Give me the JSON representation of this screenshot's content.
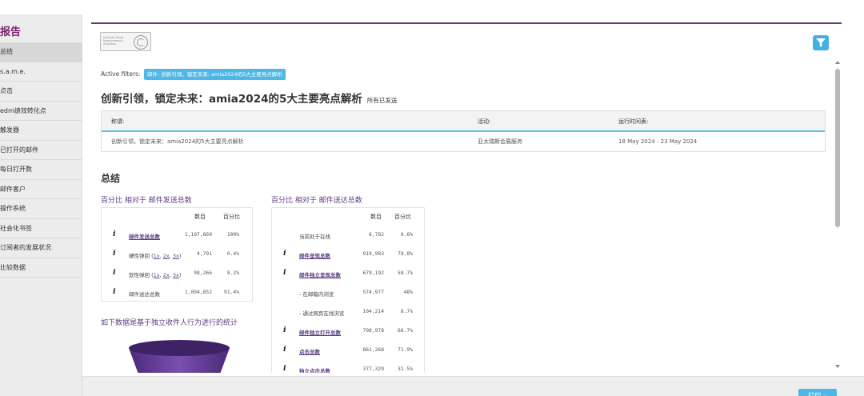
{
  "sidebar": {
    "title": "报告",
    "items": [
      "总结",
      "s.a.m.e.",
      "点击",
      "edm绩效转化点",
      "触发器",
      "已打开的邮件",
      "每日打开数",
      "邮件客户",
      "操作系统",
      "社会化书签",
      "订阅者的发展状况",
      "比较数据"
    ],
    "active_index": 0
  },
  "header": {
    "logo_text": "Institute Email Measurement Analytics",
    "filter_icon": "filter-icon"
  },
  "filters": {
    "label": "Active filters:",
    "chip": "邮件: 创新引领，锁定未来: amia2024的5大主要亮点解析"
  },
  "page": {
    "title": "创新引领，锁定未来：amia2024的5大主要亮点解析",
    "subtitle": "所有已发送"
  },
  "info_table": {
    "headers": [
      "称谓:",
      "活动:",
      "运行时间表:"
    ],
    "row": [
      "创新引领，锁定未来：amia2024的5大主要亮点解析",
      "亚太瑞斯会展服务",
      "18 May 2024 - 23 May 2024"
    ]
  },
  "summary": {
    "title": "总结",
    "left": {
      "title": "百分比 相对于 邮件发送总数",
      "col_count": "数目",
      "col_pct": "百分比",
      "rows": [
        {
          "icon": "i",
          "label": "邮件发送总数",
          "count": "1,197,869",
          "pct": "100%"
        },
        {
          "icon": "i",
          "label": "硬性弹回",
          "count": "4,791",
          "pct": "0.4%"
        },
        {
          "icon": "i",
          "label": "软性弹回",
          "count": "98,266",
          "pct": "8.2%"
        },
        {
          "icon": "i",
          "label": "邮件送达总数",
          "count": "1,094,852",
          "pct": "91.4%"
        }
      ]
    },
    "right": {
      "title": "百分比 相对于 邮件送达总数",
      "col_count": "数目",
      "col_pct": "百分比",
      "rows": [
        {
          "icon": "",
          "label": "当前处于在线",
          "count": "6,782",
          "pct": "0.6%"
        },
        {
          "icon": "i",
          "label": "邮件呈现总数",
          "count": "919,983",
          "pct": "78.8%"
        },
        {
          "icon": "i",
          "label": "邮件独立呈现总数",
          "count": "679,192",
          "pct": "58.7%"
        },
        {
          "icon": "",
          "label": "- 在邮箱内浏览",
          "count": "574,977",
          "pct": "48%"
        },
        {
          "icon": "",
          "label": "- 通过网页在线浏览",
          "count": "104,214",
          "pct": "8.7%"
        },
        {
          "icon": "i",
          "label": "邮件独立打开总数",
          "count": "798,978",
          "pct": "66.7%"
        },
        {
          "icon": "i",
          "label": "点击总数",
          "count": "861,268",
          "pct": "71.9%"
        },
        {
          "icon": "i",
          "label": "独立点击总数",
          "count": "377,329",
          "pct": "31.5%"
        }
      ]
    },
    "unique_note": "如下数据是基于独立收件人行为进行的统计"
  },
  "bounce_links": [
    "1x",
    "2x",
    "3x"
  ],
  "footer": {
    "print_label": "打印 ··"
  },
  "colors": {
    "accent_purple": "#5b3c80",
    "accent_blue": "#4eb7e6",
    "sidebar_bg": "#ececec"
  }
}
